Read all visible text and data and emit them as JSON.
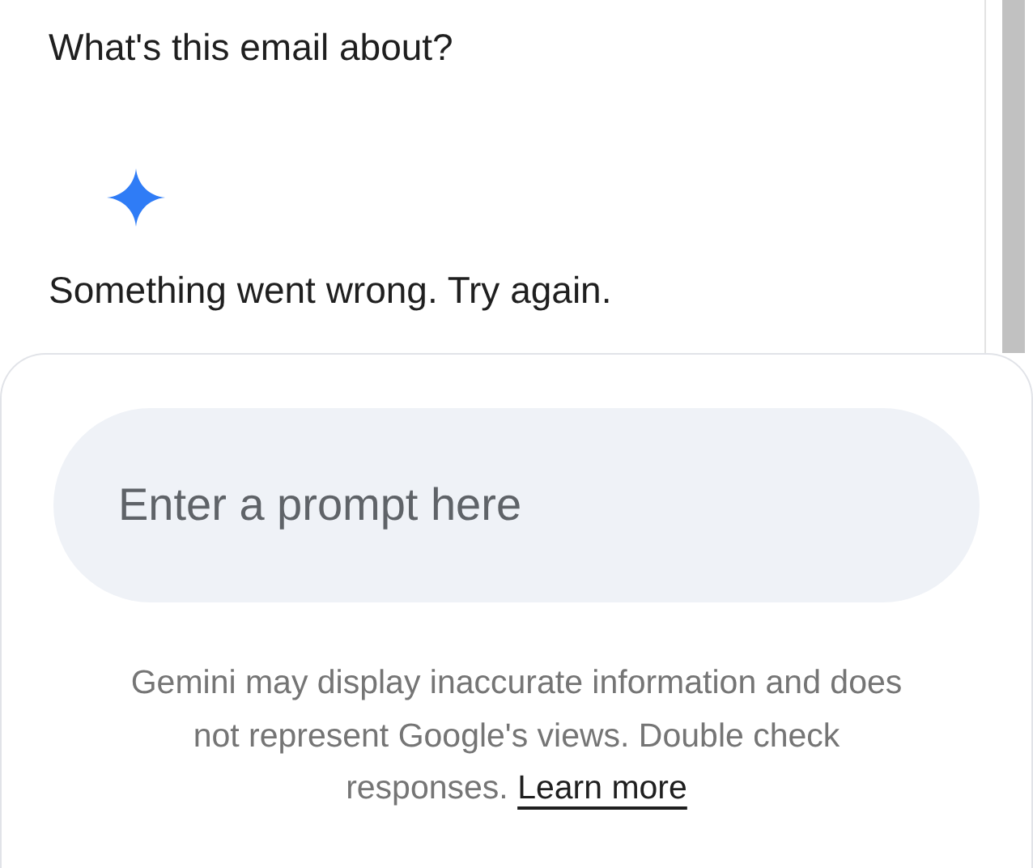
{
  "conversation": {
    "question": "What's this email about?",
    "reply": {
      "kind": "error",
      "text": "Something went wrong. Try again."
    }
  },
  "prompt": {
    "placeholder": "Enter a prompt here"
  },
  "disclaimer": {
    "text": "Gemini may display inaccurate information and does not represent Google's views. Double check responses.",
    "link": "Learn more"
  }
}
